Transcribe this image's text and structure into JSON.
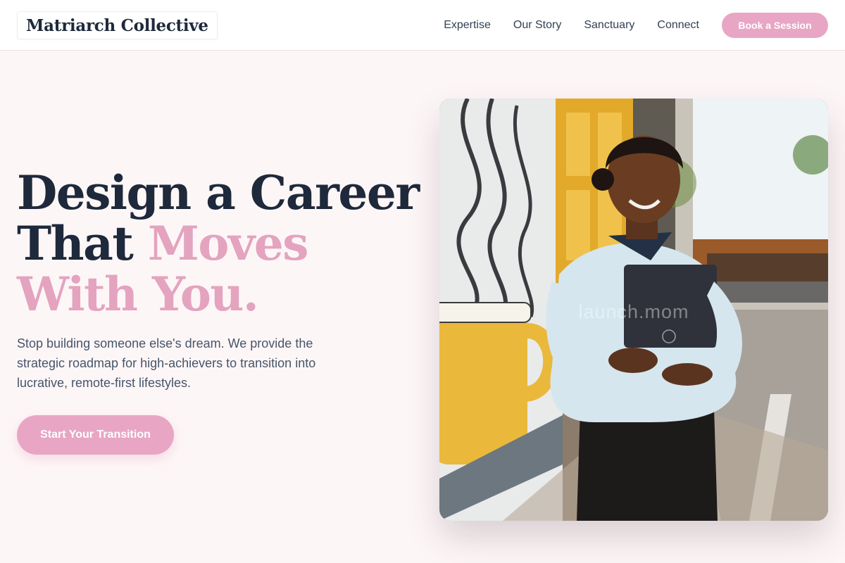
{
  "header": {
    "logo_text": "Matriarch Collective",
    "nav": [
      {
        "label": "Expertise"
      },
      {
        "label": "Our Story"
      },
      {
        "label": "Sanctuary"
      },
      {
        "label": "Connect"
      }
    ],
    "cta_label": "Book a Session"
  },
  "hero": {
    "headline_line1": "Design a Career",
    "headline_line2_dark": "That ",
    "headline_line2_accent": "Moves",
    "headline_line3": "With You.",
    "subtext": "Stop building someone else's dream. We provide the strategic roadmap for high-achievers to transition into lucrative, remote-first lifestyles.",
    "cta_label": "Start Your Transition",
    "image_watermark": "launch.mom"
  },
  "colors": {
    "accent_pink": "#e8a6c4",
    "heading_dark": "#1e293b",
    "background": "#fdf6f7"
  }
}
